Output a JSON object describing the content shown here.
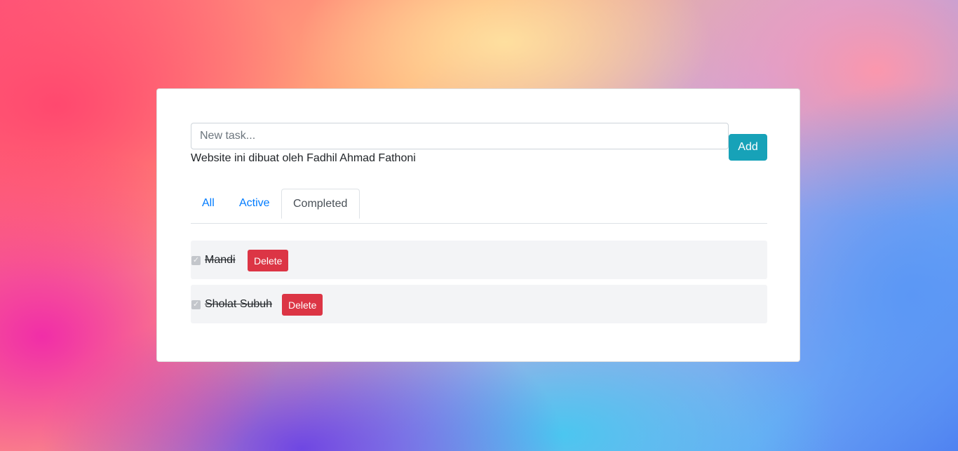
{
  "form": {
    "input_placeholder": "New task...",
    "input_value": "",
    "add_label": "Add"
  },
  "credit": "Website ini dibuat oleh Fadhil Ahmad Fathoni",
  "tabs": [
    {
      "label": "All",
      "active": false
    },
    {
      "label": "Active",
      "active": false
    },
    {
      "label": "Completed",
      "active": true
    }
  ],
  "todos": [
    {
      "text": "Mandi",
      "completed": true,
      "delete_label": "Delete"
    },
    {
      "text": "Sholat Subuh",
      "completed": true,
      "delete_label": "Delete"
    }
  ],
  "icons": {
    "checkbox": "check-icon"
  },
  "colors": {
    "add_button": "#17a2b8",
    "delete_button": "#dc3545",
    "tab_link": "#007bff"
  }
}
